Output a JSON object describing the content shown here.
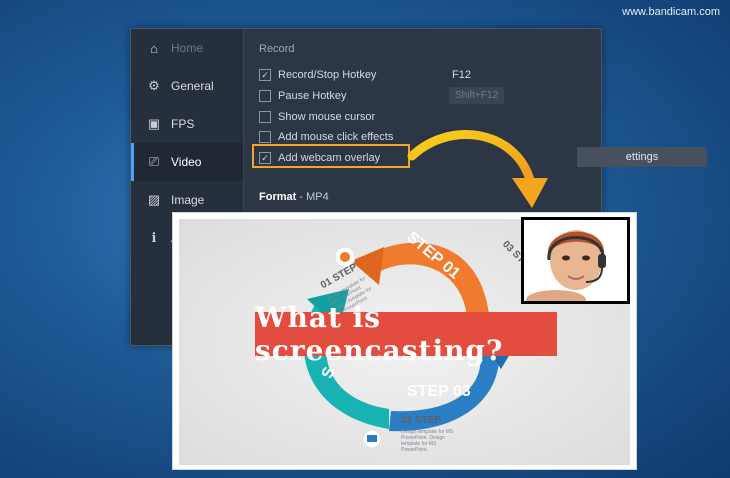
{
  "watermark": "www.bandicam.com",
  "sidebar": {
    "items": [
      {
        "label": "Home",
        "icon": "home-icon"
      },
      {
        "label": "General",
        "icon": "gear-icon"
      },
      {
        "label": "FPS",
        "icon": "fps-icon"
      },
      {
        "label": "Video",
        "icon": "video-icon"
      },
      {
        "label": "Image",
        "icon": "image-icon"
      },
      {
        "label": "A",
        "icon": "info-icon"
      }
    ]
  },
  "video": {
    "section_title": "Record",
    "options": [
      {
        "label": "Record/Stop Hotkey",
        "checked": true
      },
      {
        "label": "Pause Hotkey",
        "checked": false
      },
      {
        "label": "Show mouse cursor",
        "checked": false
      },
      {
        "label": "Add mouse click effects",
        "checked": false
      },
      {
        "label": "Add webcam overlay",
        "checked": true
      }
    ],
    "hotkey_value": "F12",
    "pause_value": "Shift+F12",
    "settings_button": "ettings",
    "format_label": "Format",
    "format_value": "- MP4"
  },
  "preview": {
    "headline": "What is screencasting?",
    "steps": {
      "step01_arrow": "STEP 01",
      "step03_arrow": "STEP 03",
      "step02_arrow": "S",
      "step01_label": "01 STEP",
      "step02_label": "02 STEP",
      "step03_label": "03 STE"
    },
    "tiny_text": "Design template for MS PowerPoint. Design template for MS PowerPoint."
  },
  "colors": {
    "highlight": "#f3a42a",
    "headline_bg": "#e24d3f",
    "orange_arrow": "#f07b2e",
    "teal_arrow": "#19b3b3",
    "blue_arrow": "#2a7fc4"
  }
}
